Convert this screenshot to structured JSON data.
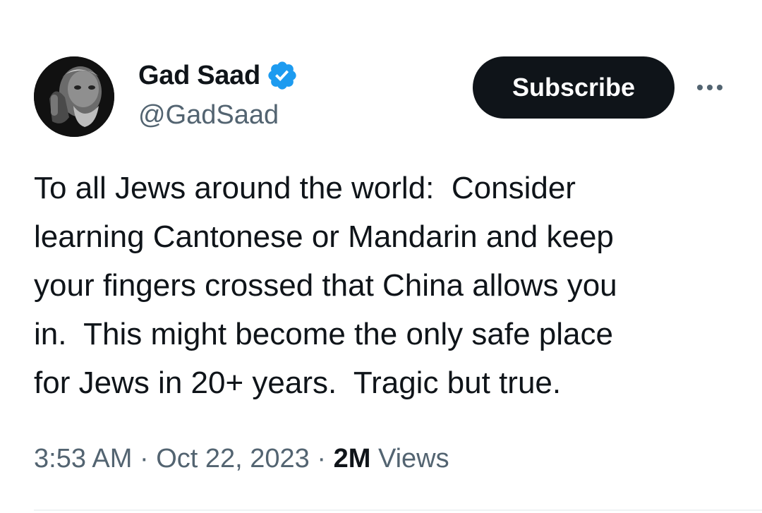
{
  "author": {
    "name": "Gad Saad",
    "handle": "@GadSaad",
    "verified": true,
    "badge_color": "#1d9bf0"
  },
  "actions": {
    "subscribe_label": "Subscribe",
    "more_icon": "more-horizontal-icon"
  },
  "tweet": {
    "text_lines": [
      "To all Jews around the world:  Consider",
      "learning Cantonese or Mandarin and keep",
      "your fingers crossed that China allows you",
      "in.  This might become the only safe place",
      "for Jews in 20+ years.  Tragic but true."
    ]
  },
  "meta": {
    "time": "3:53 AM",
    "separator": "·",
    "date": "Oct 22, 2023",
    "views_count": "2M",
    "views_label": "Views"
  },
  "colors": {
    "text_primary": "#0f1419",
    "text_secondary": "#536471",
    "button_bg": "#0f1419",
    "divider": "#eff3f4"
  }
}
